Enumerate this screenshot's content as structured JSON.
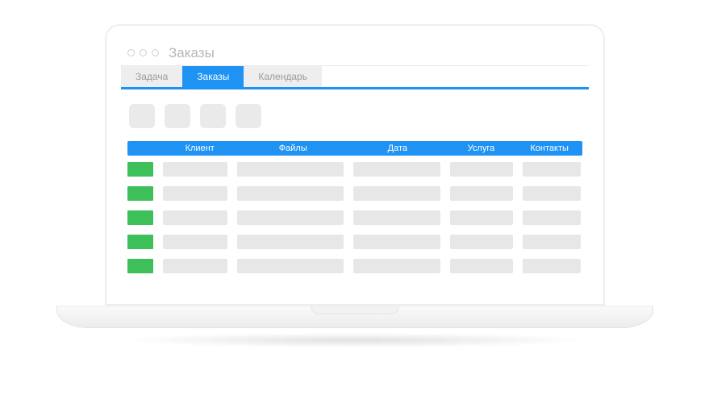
{
  "window": {
    "title": "Заказы"
  },
  "tabs": [
    {
      "label": "Задача",
      "active": false
    },
    {
      "label": "Заказы",
      "active": true
    },
    {
      "label": "Календарь",
      "active": false
    }
  ],
  "toolbar": {
    "buttons": [
      "btn1",
      "btn2",
      "btn3",
      "btn4"
    ]
  },
  "table": {
    "columns": {
      "client": "Клиент",
      "files": "Файлы",
      "date": "Дата",
      "service": "Услуга",
      "contacts": "Контакты"
    },
    "row_count": 5,
    "status_color": "#3dc05a"
  },
  "colors": {
    "accent": "#1f93f4",
    "placeholder": "#e7e7e7",
    "status_ok": "#3dc05a"
  }
}
